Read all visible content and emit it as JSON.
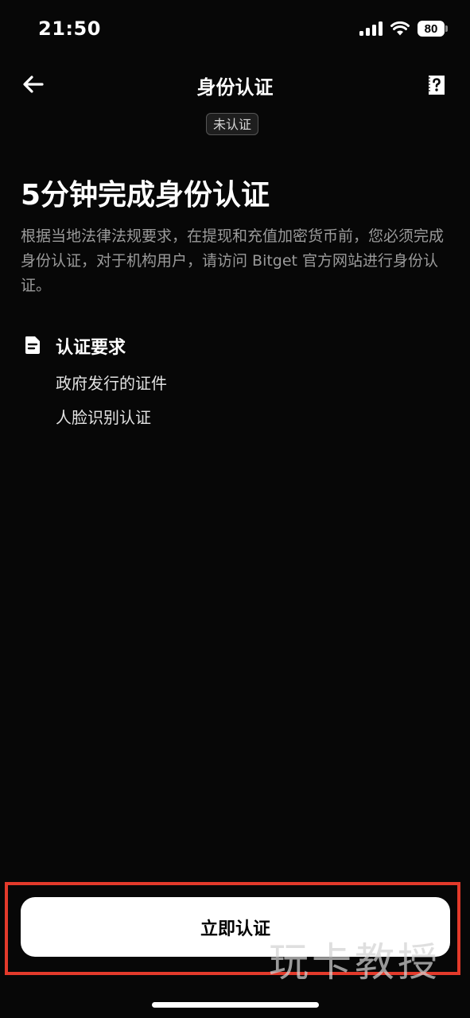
{
  "status_bar": {
    "time": "21:50",
    "battery": "80"
  },
  "nav": {
    "title": "身份认证"
  },
  "status_badge": "未认证",
  "main": {
    "title": "5分钟完成身份认证",
    "description": "根据当地法律法规要求，在提现和充值加密货币前，您必须完成身份认证，对于机构用户，请访问 Bitget 官方网站进行身份认证。"
  },
  "requirements": {
    "heading": "认证要求",
    "items": [
      "政府发行的证件",
      "人脸识别认证"
    ]
  },
  "cta": {
    "label": "立即认证"
  },
  "watermark": "玩卡教授",
  "colors": {
    "background": "#070707",
    "highlight_frame": "#e33a2b",
    "button": "#ffffff",
    "secondary_text": "#9a9a9a"
  }
}
